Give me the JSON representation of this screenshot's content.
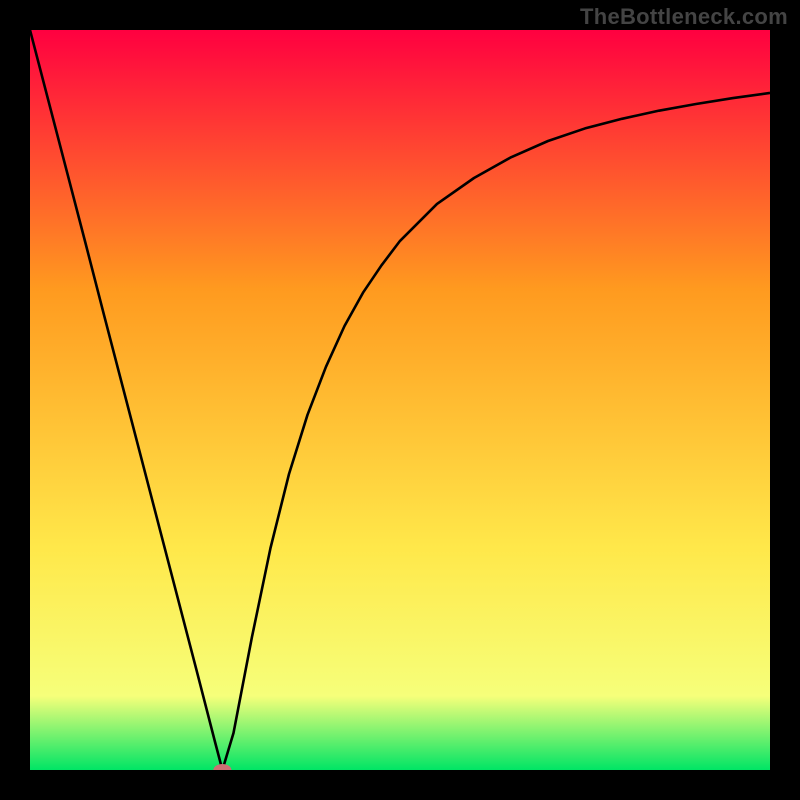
{
  "watermark": "TheBottleneck.com",
  "chart_data": {
    "type": "line",
    "title": "",
    "xlabel": "",
    "ylabel": "",
    "xlim": [
      0,
      100
    ],
    "ylim": [
      0,
      100
    ],
    "grid": false,
    "background_gradient": {
      "top": "#ff0040",
      "mid_upper": "#ff9a1f",
      "mid_lower": "#ffe84a",
      "near_bottom": "#f6ff7a",
      "bottom": "#00e565"
    },
    "series": [
      {
        "name": "bottleneck-curve",
        "color": "#000000",
        "x": [
          0,
          2.5,
          5,
          7.5,
          10,
          12.5,
          15,
          17.5,
          20,
          22.5,
          25,
          26,
          27.5,
          30,
          32.5,
          35,
          37.5,
          40,
          42.5,
          45,
          47.5,
          50,
          55,
          60,
          65,
          70,
          75,
          80,
          85,
          90,
          95,
          100
        ],
        "values": [
          100,
          90.4,
          80.8,
          71.2,
          61.5,
          51.9,
          42.3,
          32.7,
          23.1,
          13.5,
          3.8,
          0,
          5,
          18,
          30,
          40,
          48,
          54.5,
          60,
          64.5,
          68.2,
          71.5,
          76.5,
          80,
          82.8,
          85,
          86.7,
          88,
          89.1,
          90,
          90.8,
          91.5
        ]
      }
    ],
    "marker": {
      "name": "optimal-point",
      "x": 26,
      "y": 0,
      "color": "#cc6f73"
    }
  }
}
